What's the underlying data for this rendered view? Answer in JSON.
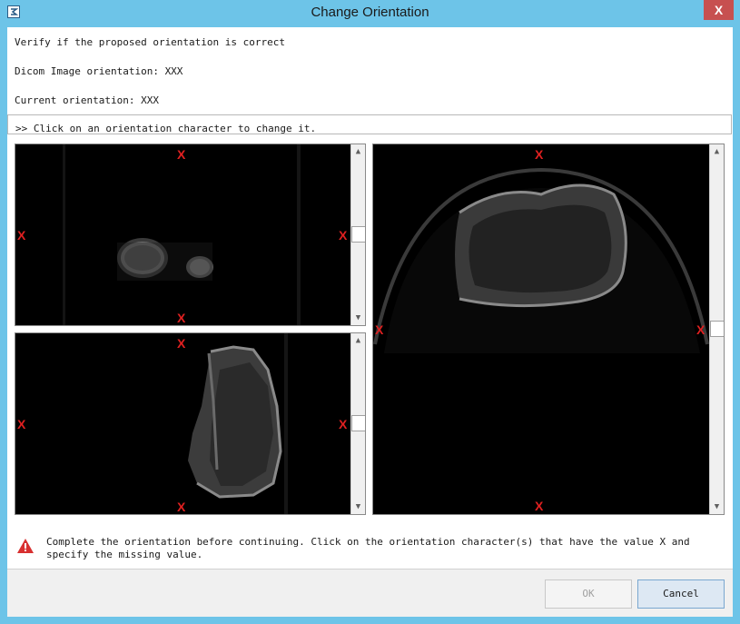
{
  "window": {
    "title": "Change Orientation",
    "close_glyph": "X"
  },
  "messages": {
    "verify": "Verify if the proposed orientation is correct",
    "dicom": "Dicom Image orientation: XXX",
    "current": "Current orientation: XXX",
    "instruction": ">> Click on an orientation character to change it."
  },
  "viewers": {
    "top_left": {
      "top": "X",
      "left": "X",
      "right": "X",
      "bottom": "X"
    },
    "bottom_left": {
      "top": "X",
      "left": "X",
      "right": "X",
      "bottom": "X"
    },
    "right": {
      "top": "X",
      "left": "X",
      "right": "X",
      "bottom": "X"
    }
  },
  "scrollbar": {
    "up_glyph": "▲",
    "down_glyph": "▼"
  },
  "warning": {
    "icon": "warning-triangle-icon",
    "text": "Complete the orientation before continuing. Click on the orientation character(s) that have the value X and specify the missing value."
  },
  "buttons": {
    "ok": "OK",
    "cancel": "Cancel"
  },
  "colors": {
    "titlebar": "#6dc4e8",
    "orientation_marker": "#e02020",
    "close": "#c75050"
  }
}
